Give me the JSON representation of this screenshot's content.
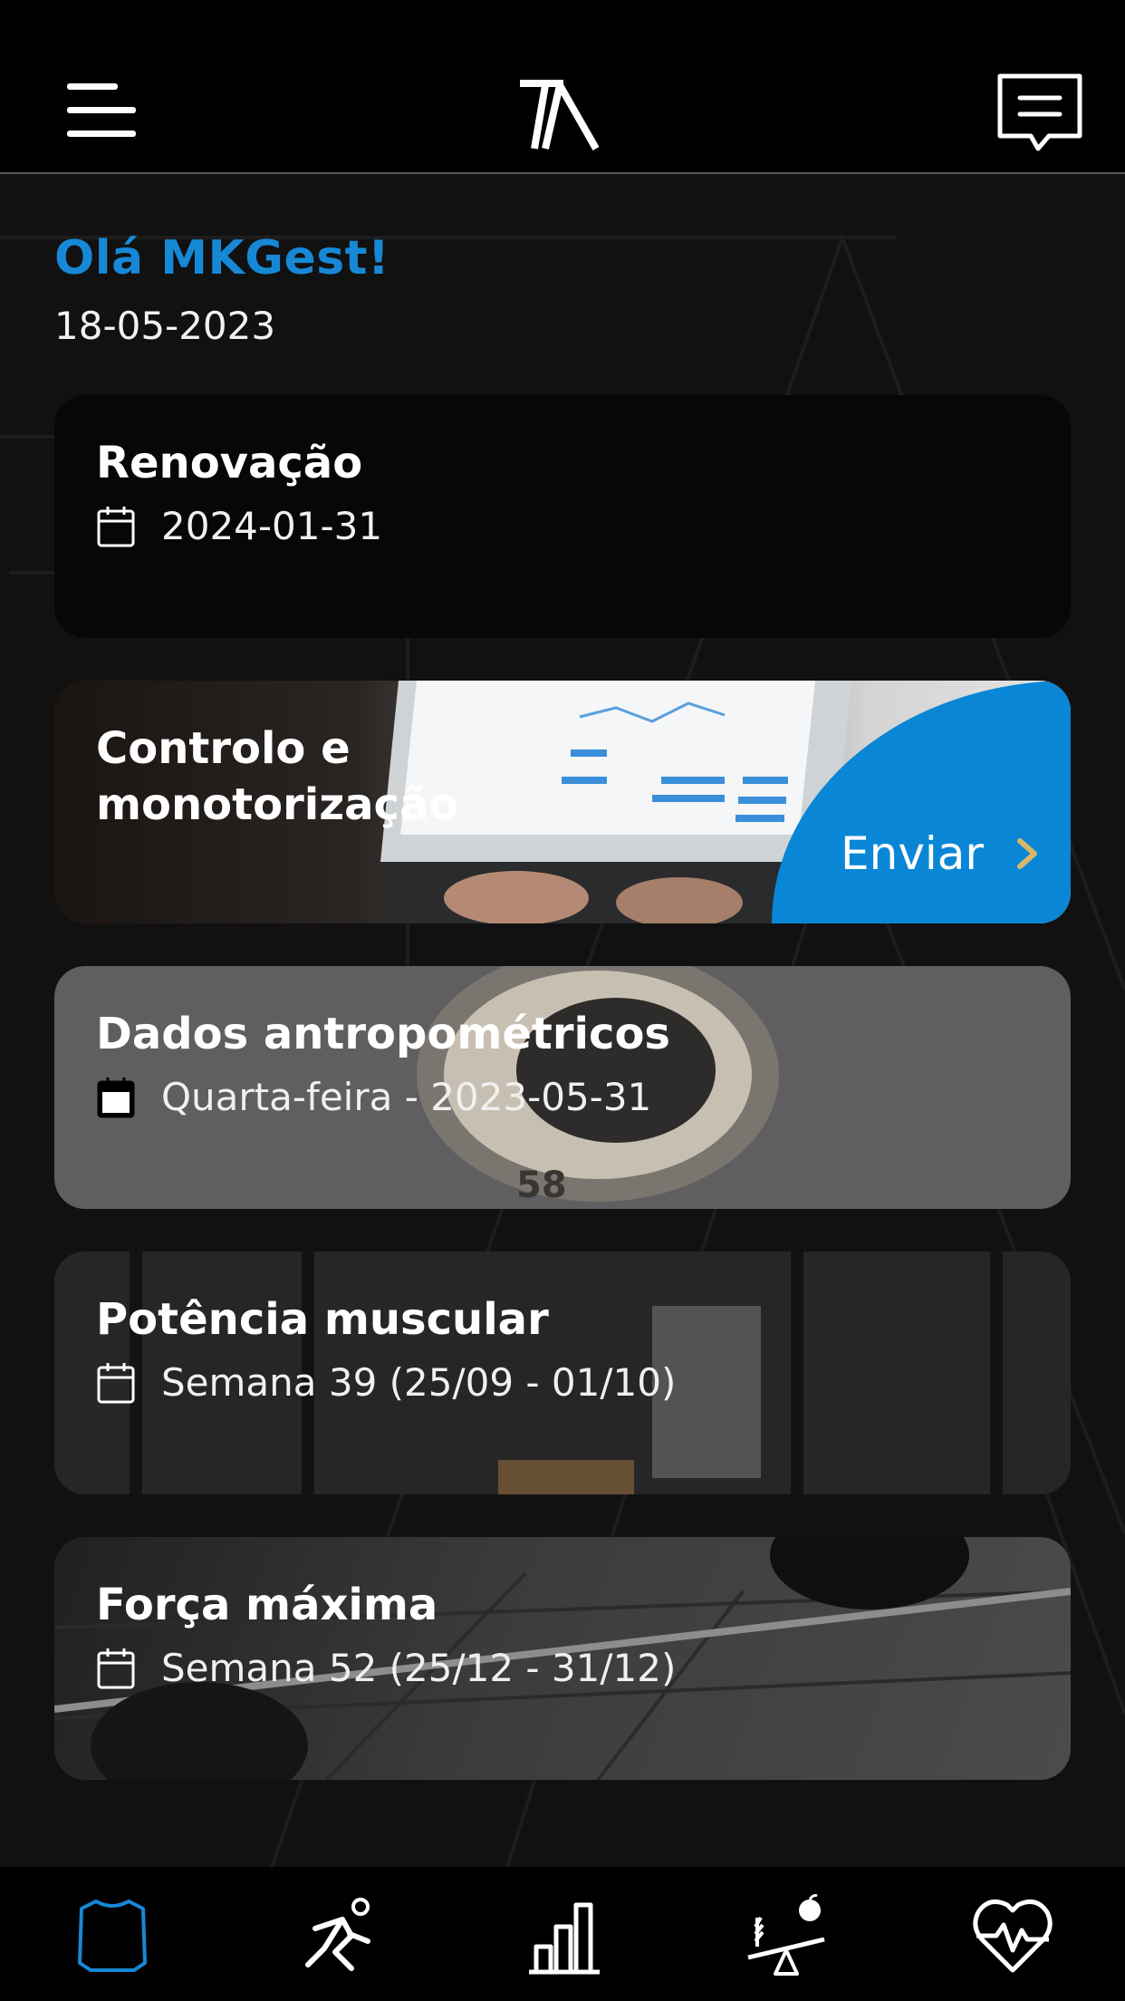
{
  "header": {
    "menu_icon": "hamburger-menu-icon",
    "logo_icon": "ta-logo",
    "chat_icon": "chat-message-icon"
  },
  "greeting": {
    "title": "Olá MKGest!",
    "date": "18-05-2023"
  },
  "cards": {
    "renovacao": {
      "title": "Renovação",
      "date": "2024-01-31"
    },
    "controlo": {
      "title_line1": "Controlo e",
      "title_line2": "monotorização",
      "button_label": "Enviar"
    },
    "dados": {
      "title": "Dados antropométricos",
      "date": "Quarta-feira - 2023-05-31"
    },
    "potencia": {
      "title": "Potência muscular",
      "date": "Semana 39 (25/09 - 01/10)"
    },
    "forca": {
      "title": "Força máxima",
      "date": "Semana 52 (25/12 - 31/12)"
    }
  },
  "bottom_nav": {
    "items": [
      {
        "icon": "shirt-icon",
        "active": true
      },
      {
        "icon": "running-icon",
        "active": false
      },
      {
        "icon": "bar-chart-icon",
        "active": false
      },
      {
        "icon": "nutrition-balance-icon",
        "active": false
      },
      {
        "icon": "heart-pulse-icon",
        "active": false
      }
    ]
  },
  "colors": {
    "accent": "#1788d6",
    "button_blue": "#0a86d6",
    "chevron": "#d9b66a",
    "background": "#111111"
  }
}
